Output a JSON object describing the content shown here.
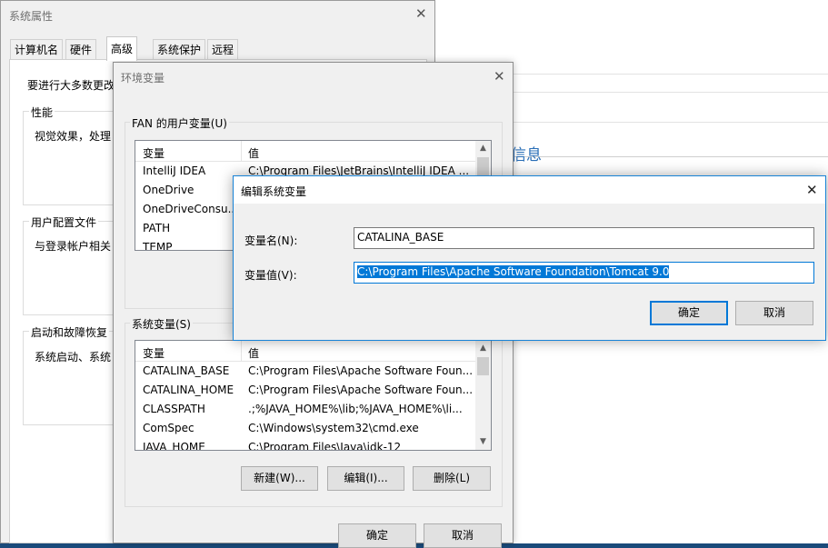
{
  "background_window": {
    "heading_fragment": "信息"
  },
  "system_properties": {
    "title": "系统属性",
    "tabs": [
      "计算机名",
      "硬件",
      "高级",
      "系统保护",
      "远程"
    ],
    "active_tab": "高级",
    "intro_text": "要进行大多数更改",
    "groups": {
      "performance": {
        "label": "性能",
        "desc": "视觉效果，处理"
      },
      "user_profiles": {
        "label": "用户配置文件",
        "desc": "与登录帐户相关"
      },
      "startup": {
        "label": "启动和故障恢复",
        "desc": "系统启动、系统"
      }
    }
  },
  "env_vars": {
    "title": "环境变量",
    "user_section_label": "FAN 的用户变量(U)",
    "columns": {
      "name": "变量",
      "value": "值"
    },
    "user_vars": [
      {
        "name": "IntelliJ IDEA",
        "value": "C:\\Program Files\\JetBrains\\IntelliJ IDEA ..."
      },
      {
        "name": "OneDrive",
        "value": ""
      },
      {
        "name": "OneDriveConsu...",
        "value": ""
      },
      {
        "name": "PATH",
        "value": ""
      },
      {
        "name": "TEMP",
        "value": ""
      }
    ],
    "system_section_label": "系统变量(S)",
    "system_vars": [
      {
        "name": "CATALINA_BASE",
        "value": "C:\\Program Files\\Apache Software Foun..."
      },
      {
        "name": "CATALINA_HOME",
        "value": "C:\\Program Files\\Apache Software Foun..."
      },
      {
        "name": "CLASSPATH",
        "value": ".;%JAVA_HOME%\\lib;%JAVA_HOME%\\li..."
      },
      {
        "name": "ComSpec",
        "value": "C:\\Windows\\system32\\cmd.exe"
      },
      {
        "name": "JAVA_HOME",
        "value": "C:\\Program Files\\Java\\jdk-12"
      }
    ],
    "buttons": {
      "new": "新建(W)...",
      "edit": "编辑(I)...",
      "delete": "删除(L)",
      "ok": "确定",
      "cancel": "取消"
    }
  },
  "edit_dialog": {
    "title": "编辑系统变量",
    "name_label": "变量名(N):",
    "name_value": "CATALINA_BASE",
    "value_label": "变量值(V):",
    "value_value": "C:\\Program Files\\Apache Software Foundation\\Tomcat 9.0",
    "ok": "确定",
    "cancel": "取消"
  },
  "icons": {
    "close": "close-icon",
    "scroll_up": "chevron-up-icon",
    "scroll_down": "chevron-down-icon"
  },
  "colors": {
    "accent": "#0078d7",
    "selection": "#0078d7",
    "dialog_bg": "#f0f0f0"
  }
}
